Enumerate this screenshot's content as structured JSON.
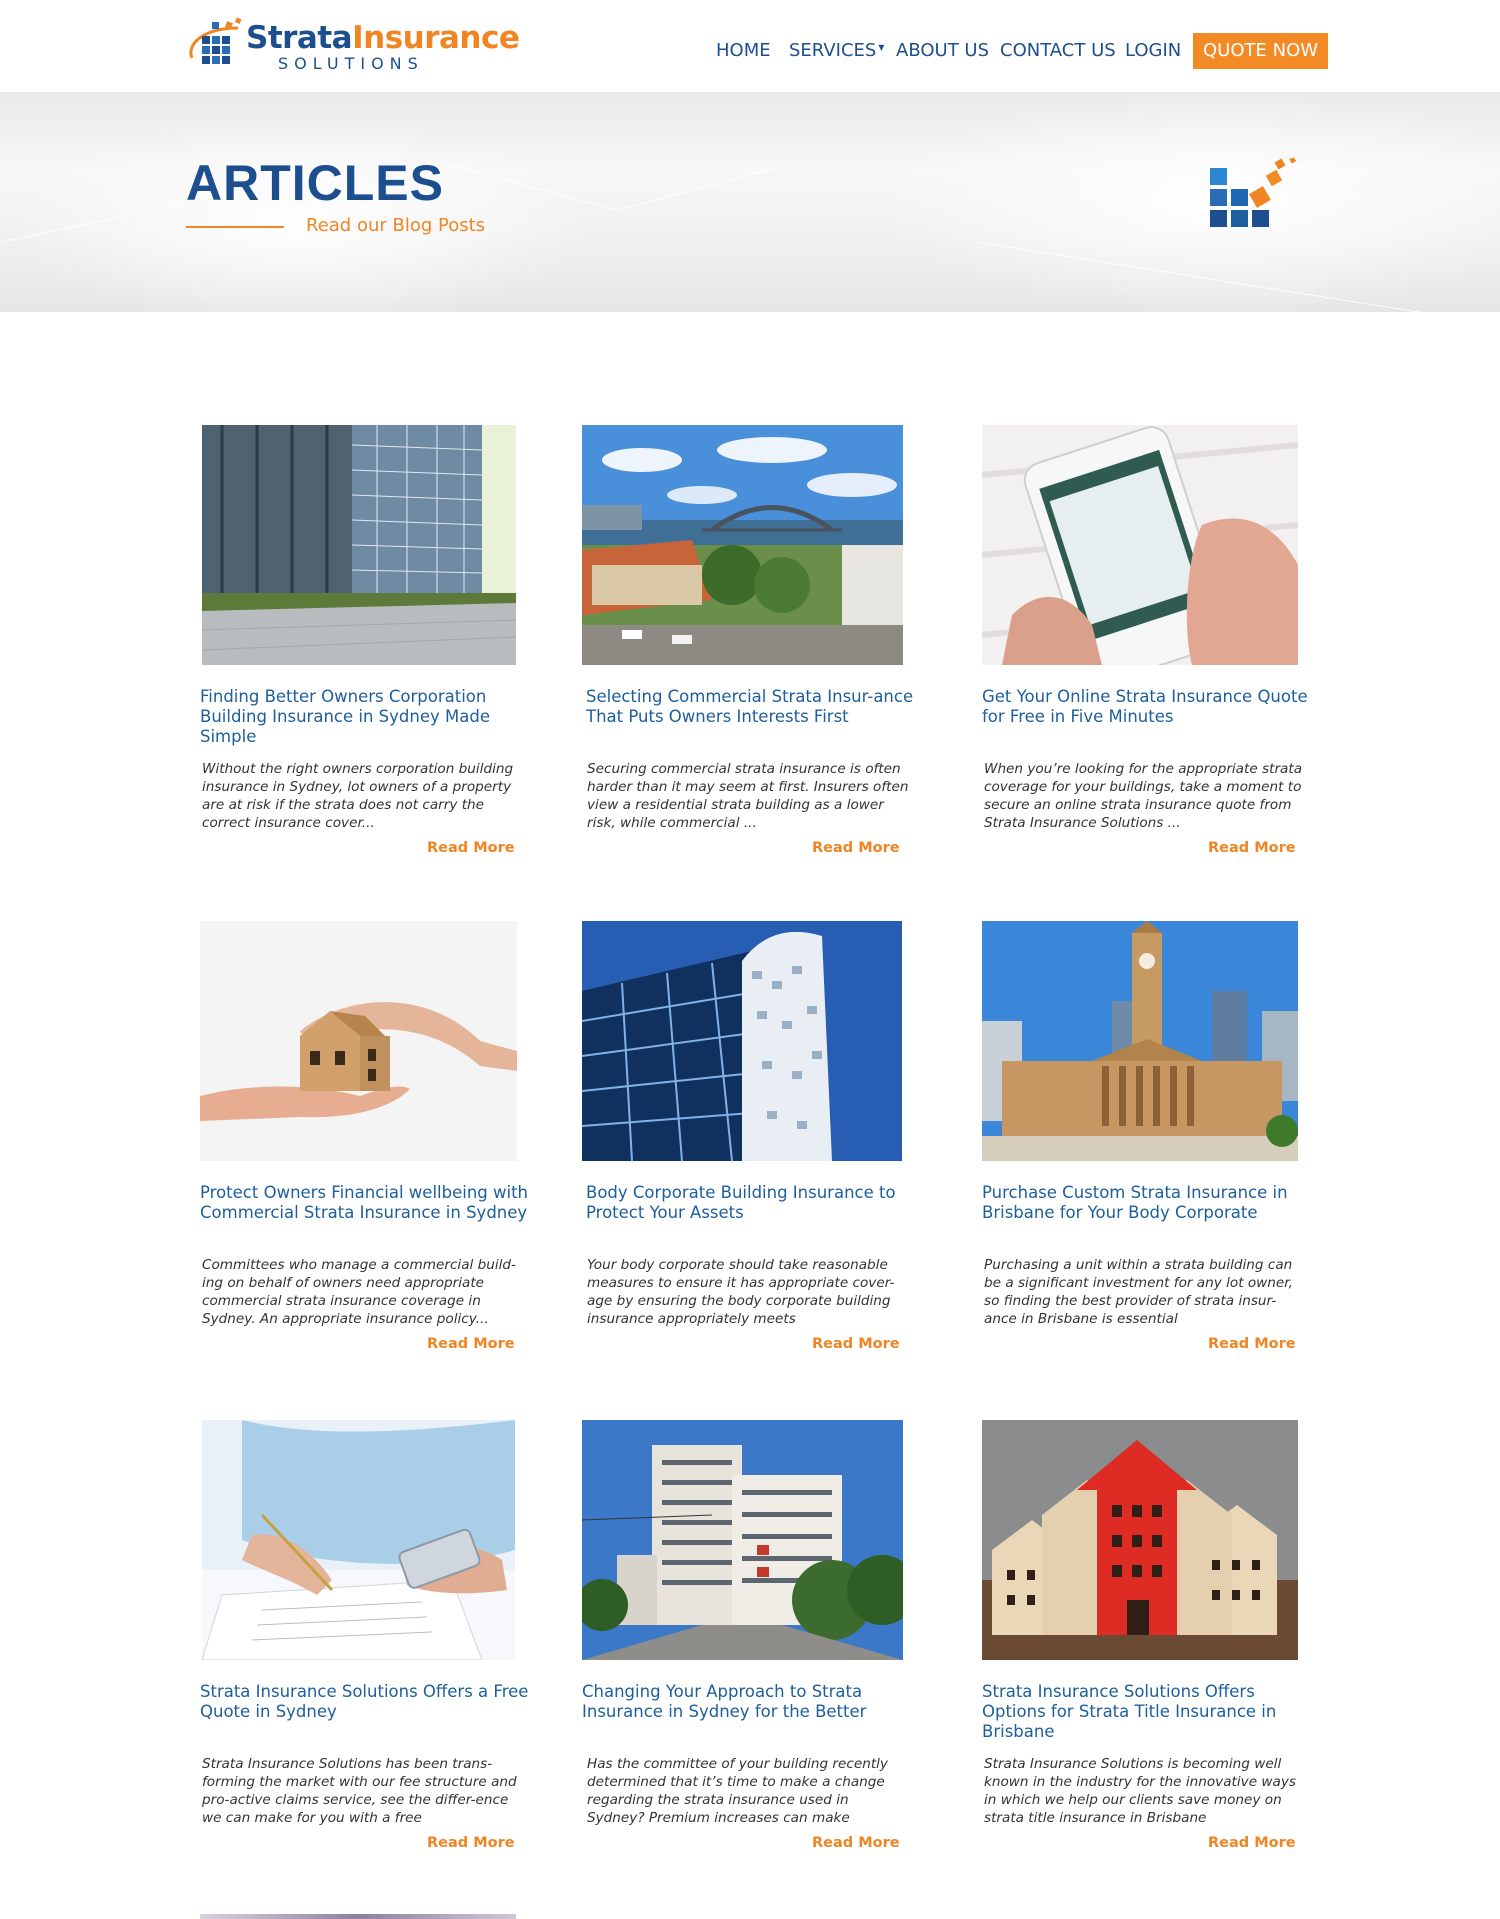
{
  "brand": {
    "name_part1": "Strata",
    "name_part2": "Insurance",
    "tagline": "SOLUTIONS",
    "blue": "#1d4f8f",
    "orange": "#ef8523"
  },
  "nav": {
    "items": [
      {
        "label": "HOME"
      },
      {
        "label": "SERVICES",
        "caret": "▾"
      },
      {
        "label": "ABOUT US"
      },
      {
        "label": "CONTACT US"
      },
      {
        "label": "LOGIN"
      }
    ],
    "quote_label": "QUOTE NOW"
  },
  "hero": {
    "title": "ARTICLES",
    "subtitle": "Read our Blog Posts"
  },
  "articles": [
    {
      "title": "Finding Better Owners Corporation Building Insurance in Sydney Made Simple",
      "excerpt": "Without the right owners corporation building insurance in Sydney, lot owners of a property are at risk if the strata does not carry the correct insurance cover...",
      "more": "Read More",
      "image": "glass-office-tower-plaza"
    },
    {
      "title": "Selecting Commercial Strata Insur-ance That Puts Owners Interests First",
      "excerpt": "Securing commercial strata insurance is often harder than it may seem at first. Insurers often view a residential strata building as a lower risk, while commercial ...",
      "more": "Read More",
      "image": "sydney-harbour-bridge-view"
    },
    {
      "title": "Get Your Online Strata Insurance Quote for Free in Five Minutes",
      "excerpt": "When you’re looking for the appropriate strata coverage for your buildings, take a moment to secure an online strata insurance quote from Strata Insurance Solutions ...",
      "more": "Read More",
      "image": "hands-holding-smartphone"
    },
    {
      "title": "Protect Owners Financial wellbeing with Commercial Strata Insurance in Sydney",
      "excerpt": "Committees who manage a commercial build-ing on behalf of owners need appropriate commercial strata insurance coverage in Sydney. An appropriate insurance policy...",
      "more": "Read More",
      "image": "hands-protecting-wooden-house"
    },
    {
      "title": "Body Corporate Building Insurance to Protect Your Assets",
      "excerpt": "Your body corporate should take reasonable measures to ensure it has appropriate cover-age by ensuring the body corporate building insurance appropriately meets",
      "more": "Read More",
      "image": "curved-glass-skyscraper"
    },
    {
      "title": "Purchase Custom Strata Insurance in Brisbane for Your Body Corporate",
      "excerpt": "Purchasing a unit within a strata building can be a significant investment for any lot owner, so finding the best provider of strata insur-ance in Brisbane is essential",
      "more": "Read More",
      "image": "brisbane-city-hall-clock-tower"
    },
    {
      "title": "Strata Insurance Solutions Offers a Free Quote in Sydney",
      "excerpt": "Strata Insurance Solutions has been trans-forming the market with our fee structure and pro-active claims service, see the differ-ence we can make for you with a free",
      "more": "Read More",
      "image": "person-signing-document-with-phone"
    },
    {
      "title": "Changing Your Approach to Strata Insurance in Sydney for the Better",
      "excerpt": "Has the committee of your building recently determined that it’s time to make a change regarding the strata insurance used in Sydney? Premium increases can make",
      "more": "Read More",
      "image": "apartment-towers-street"
    },
    {
      "title": "Strata Insurance Solutions Offers Options for Strata Title Insurance in Brisbane",
      "excerpt": "Strata Insurance Solutions is becoming well known in the industry for the innovative ways in which we help our clients save money on strata title insurance in Brisbane",
      "more": "Read More",
      "image": "wooden-houses-red-arrow-model"
    }
  ]
}
